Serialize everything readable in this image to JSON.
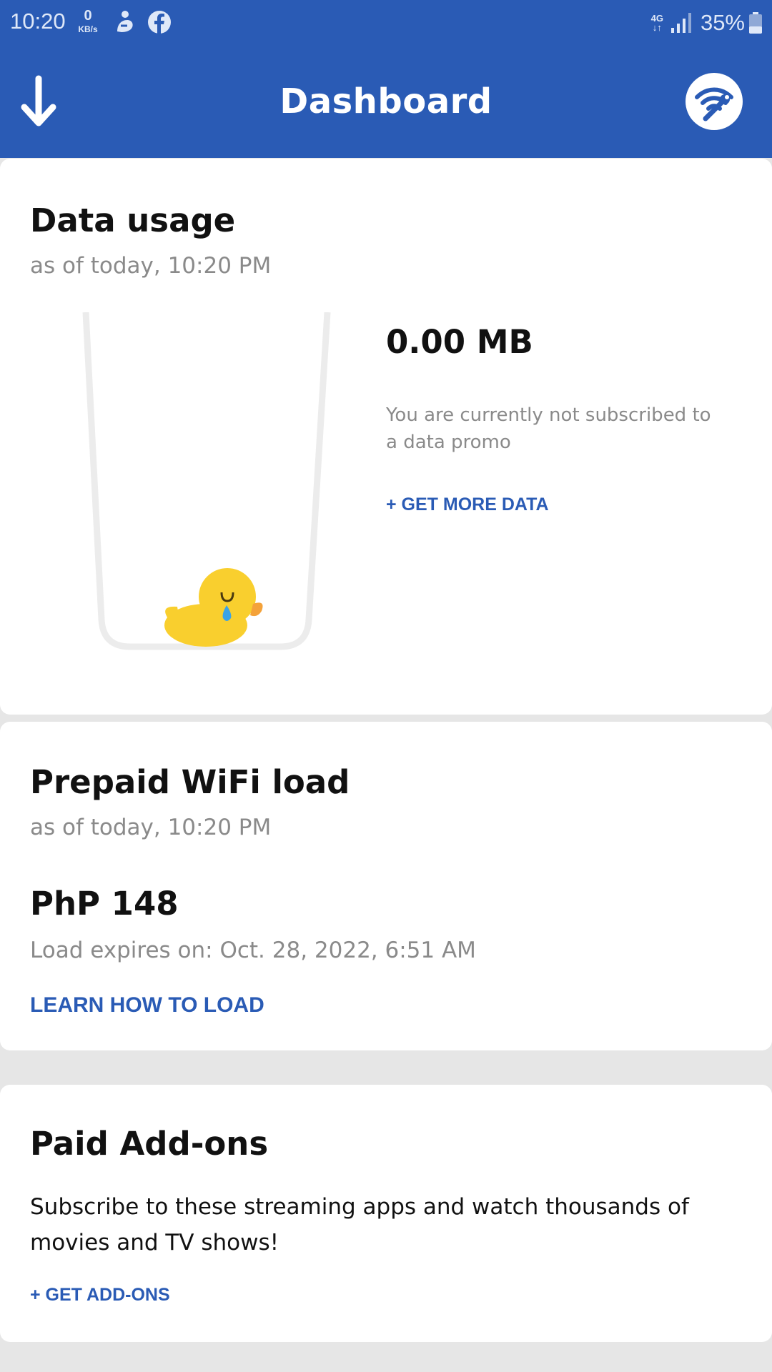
{
  "status_bar": {
    "time": "10:20",
    "net_speed_value": "0",
    "net_speed_unit": "KB/s",
    "network_type": "4G",
    "battery_percent": "35%",
    "icons": [
      "notification-icon",
      "facebook-icon",
      "data-arrows-icon",
      "signal-icon",
      "battery-icon"
    ]
  },
  "app_bar": {
    "title": "Dashboard",
    "left_icon": "download-arrow-icon",
    "right_icon": "wifi-wrench-icon"
  },
  "data_usage": {
    "title": "Data usage",
    "subtitle": "as of today, 10:20 PM",
    "amount": "0.00 MB",
    "note": "You are currently not subscribed to a data promo",
    "action": "+ GET MORE DATA",
    "fill_fraction": 0
  },
  "prepaid_load": {
    "title": "Prepaid WiFi load",
    "subtitle": "as of today, 10:20 PM",
    "amount": "PhP 148",
    "expiry": "Load expires on: Oct. 28, 2022, 6:51 AM",
    "action": "LEARN HOW TO LOAD"
  },
  "paid_addons": {
    "title": "Paid Add-ons",
    "description": "Subscribe to these streaming apps and watch thousands of movies and TV shows!",
    "action": "+ GET ADD-ONS"
  },
  "colors": {
    "brand_blue": "#2a5bb5",
    "duck_yellow": "#f9cf2e",
    "muted_text": "#8a8a8a"
  }
}
